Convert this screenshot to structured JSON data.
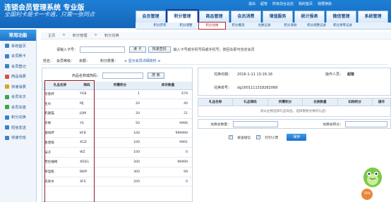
{
  "header": {
    "brand": "连锁会员管理系统 专业版",
    "slogan": "全国利卡是卡一卡通，只需一张同点",
    "user_items": [
      "退出",
      "超管",
      "所有前台总店",
      "我的首页",
      "我要换肤"
    ],
    "tabs": [
      "会员管理",
      "积分管理",
      "商品管理",
      "会员消费",
      "增值服务",
      "统计报表",
      "微信管理",
      "系统管理"
    ],
    "active_tab": 1
  },
  "subnav": {
    "items": [
      "积分存率",
      "积分调整",
      "积分兑换",
      "积分撤消",
      "兑换记录",
      "积分清除",
      "积分调整记录",
      "积分清零记录"
    ],
    "active": 2
  },
  "sidebar": {
    "title": "常用功能",
    "items": [
      {
        "label": "系统首页",
        "icon": "home-icon",
        "color": "#3b82c4"
      },
      {
        "label": "会员刷卡",
        "icon": "card-icon",
        "color": "#3b82c4"
      },
      {
        "label": "会员登记",
        "icon": "user-add-icon",
        "color": "#3b82c4"
      },
      {
        "label": "商品消费",
        "icon": "cart-icon",
        "color": "#d94e4e"
      },
      {
        "label": "快速消费",
        "icon": "lightning-icon",
        "color": "#e3a21a"
      },
      {
        "label": "会员充次",
        "icon": "refresh-icon",
        "color": "#3fa34d"
      },
      {
        "label": "会员充值",
        "icon": "coin-icon",
        "color": "#3fa34d"
      },
      {
        "label": "积分兑换",
        "icon": "gift-icon",
        "color": "#3b82c4"
      },
      {
        "label": "短信发送",
        "icon": "sms-icon",
        "color": "#3b82c4"
      },
      {
        "label": "快速交班",
        "icon": "handover-icon",
        "color": "#3b82c4"
      }
    ]
  },
  "breadcrumb": {
    "items": [
      "主页",
      "积分管理",
      "积分兑换"
    ],
    "separator": ">"
  },
  "card_search": {
    "label": "请输入卡号：",
    "read_button": "读 卡",
    "quick_button": "快速查找",
    "hint": "输入卡号或手机号码或手机号，按回车即可完定会员"
  },
  "member_info": {
    "name_label": "姓名：",
    "level_label": "会员等级：",
    "balance_label": "余额：",
    "points_label": "积分数量：",
    "detail_link": "≥ 显示会员详细资料 ≤"
  },
  "product_search": {
    "label": "商品名称或简码：",
    "button": "搜 索"
  },
  "product_table": {
    "headers": [
      "礼品名称",
      "简码",
      "所需积分",
      "库存数量"
    ],
    "rows": [
      [
        "牙膏杯",
        "YGB",
        "1",
        "679"
      ],
      [
        "毛巾",
        "MJ",
        "20",
        "40"
      ],
      [
        "机器猫",
        "JQM",
        "20",
        "21"
      ],
      [
        "牙刷",
        "YS",
        "50",
        "9996"
      ],
      [
        "咖啡杯",
        "KFB",
        "100",
        "999999"
      ],
      [
        "香港珠",
        "XGZ",
        "100",
        "9991"
      ],
      [
        "袜子",
        "WZ",
        "100",
        "0"
      ],
      [
        "西拉抽绳",
        "XRSG",
        "200",
        "99999"
      ],
      [
        "保温瓶",
        "BWP",
        "300",
        "99"
      ],
      [
        "洗发水",
        "XFS",
        "200",
        "0"
      ]
    ]
  },
  "exchange": {
    "date_label": "兑换日期：",
    "date_value": "2016-1-11 13:16:18",
    "operator_label": "操作人员：",
    "operator_value": "超管",
    "order_label": "兑换单号：",
    "order_value": "dg1601111318282068",
    "table_headers": [
      "礼品名称",
      "礼品简码",
      "所需积分",
      "兑换数量",
      "扣除积分",
      "操作"
    ],
    "empty_text": "请从左侧选择礼品商品，选择需要兑换的礼品！",
    "total_count_label": "兑换总数量：",
    "total_points_label": "兑换总积分：",
    "send_sms_label": "发送短信",
    "print_label": "打印小票",
    "save_button": "保存"
  },
  "float_badge": "78%",
  "colors": {
    "header_blue": "#1566b8",
    "highlight": "#8b1f2b",
    "active_tab_outline": "#1b3f8f"
  }
}
